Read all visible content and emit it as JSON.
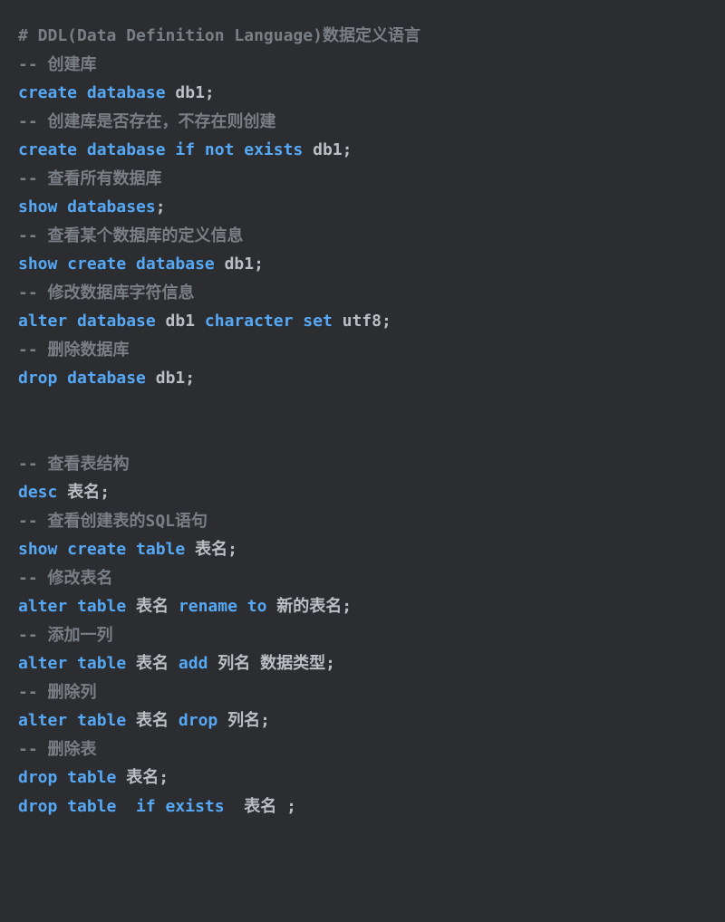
{
  "lines": [
    [
      {
        "cls": "cmt",
        "t": "# DDL(Data Definition Language)数据定义语言"
      }
    ],
    [
      {
        "cls": "cmt",
        "t": "-- 创建库"
      }
    ],
    [
      {
        "cls": "kw",
        "t": "create database"
      },
      {
        "cls": "id",
        "t": " db1"
      },
      {
        "cls": "punc",
        "t": ";"
      }
    ],
    [
      {
        "cls": "cmt",
        "t": "-- 创建库是否存在，不存在则创建"
      }
    ],
    [
      {
        "cls": "kw",
        "t": "create database if not exists"
      },
      {
        "cls": "id",
        "t": " db1"
      },
      {
        "cls": "punc",
        "t": ";"
      }
    ],
    [
      {
        "cls": "cmt",
        "t": "-- 查看所有数据库"
      }
    ],
    [
      {
        "cls": "kw",
        "t": "show databases"
      },
      {
        "cls": "punc",
        "t": ";"
      }
    ],
    [
      {
        "cls": "cmt",
        "t": "-- 查看某个数据库的定义信息"
      }
    ],
    [
      {
        "cls": "kw",
        "t": "show create database"
      },
      {
        "cls": "id",
        "t": " db1"
      },
      {
        "cls": "punc",
        "t": ";"
      }
    ],
    [
      {
        "cls": "cmt",
        "t": "-- 修改数据库字符信息"
      }
    ],
    [
      {
        "cls": "kw",
        "t": "alter database"
      },
      {
        "cls": "id",
        "t": " db1 "
      },
      {
        "cls": "kw",
        "t": "character set"
      },
      {
        "cls": "id",
        "t": " utf8"
      },
      {
        "cls": "punc",
        "t": ";"
      }
    ],
    [
      {
        "cls": "cmt",
        "t": "-- 删除数据库"
      }
    ],
    [
      {
        "cls": "kw",
        "t": "drop database"
      },
      {
        "cls": "id",
        "t": " db1"
      },
      {
        "cls": "punc",
        "t": ";"
      }
    ],
    [
      {
        "cls": "id",
        "t": ""
      }
    ],
    [
      {
        "cls": "id",
        "t": ""
      }
    ],
    [
      {
        "cls": "cmt",
        "t": "-- 查看表结构"
      }
    ],
    [
      {
        "cls": "kw",
        "t": "desc"
      },
      {
        "cls": "id",
        "t": " 表名"
      },
      {
        "cls": "punc",
        "t": ";"
      }
    ],
    [
      {
        "cls": "cmt",
        "t": "-- 查看创建表的SQL语句"
      }
    ],
    [
      {
        "cls": "kw",
        "t": "show create table"
      },
      {
        "cls": "id",
        "t": " 表名"
      },
      {
        "cls": "punc",
        "t": ";"
      }
    ],
    [
      {
        "cls": "cmt",
        "t": "-- 修改表名"
      }
    ],
    [
      {
        "cls": "kw",
        "t": "alter table"
      },
      {
        "cls": "id",
        "t": " 表名 "
      },
      {
        "cls": "kw",
        "t": "rename to"
      },
      {
        "cls": "id",
        "t": " 新的表名"
      },
      {
        "cls": "punc",
        "t": ";"
      }
    ],
    [
      {
        "cls": "cmt",
        "t": "-- 添加一列"
      }
    ],
    [
      {
        "cls": "kw",
        "t": "alter table"
      },
      {
        "cls": "id",
        "t": " 表名 "
      },
      {
        "cls": "kw",
        "t": "add"
      },
      {
        "cls": "id",
        "t": " 列名 数据类型"
      },
      {
        "cls": "punc",
        "t": ";"
      }
    ],
    [
      {
        "cls": "cmt",
        "t": "-- 删除列"
      }
    ],
    [
      {
        "cls": "kw",
        "t": "alter table"
      },
      {
        "cls": "id",
        "t": " 表名 "
      },
      {
        "cls": "kw",
        "t": "drop"
      },
      {
        "cls": "id",
        "t": " 列名"
      },
      {
        "cls": "punc",
        "t": ";"
      }
    ],
    [
      {
        "cls": "cmt",
        "t": "-- 删除表"
      }
    ],
    [
      {
        "cls": "kw",
        "t": "drop table"
      },
      {
        "cls": "id",
        "t": " 表名"
      },
      {
        "cls": "punc",
        "t": ";"
      }
    ],
    [
      {
        "cls": "kw",
        "t": "drop table  if exists "
      },
      {
        "cls": "id",
        "t": " 表名 "
      },
      {
        "cls": "punc",
        "t": ";"
      }
    ]
  ]
}
